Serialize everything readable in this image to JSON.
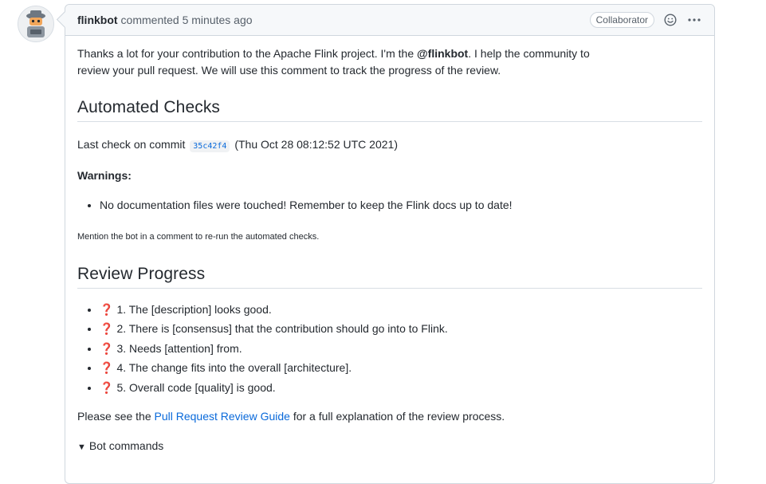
{
  "author": "flinkbot",
  "comment_action": "commented 5 minutes ago",
  "badge": "Collaborator",
  "intro": {
    "part1": "Thanks a lot for your contribution to the Apache Flink project. I'm the ",
    "mention": "@flinkbot",
    "part2": ". I help the community to review your pull request. We will use this comment to track the progress of the review."
  },
  "automated_checks": {
    "heading": "Automated Checks",
    "last_check_prefix": "Last check on commit",
    "commit_sha": "35c42f4",
    "last_check_date": "(Thu Oct 28 08:12:52 UTC 2021)",
    "warnings_label": "Warnings:",
    "warnings": [
      "No documentation files were touched! Remember to keep the Flink docs up to date!"
    ],
    "rerun_note": "Mention the bot in a comment to re-run the automated checks."
  },
  "review_progress": {
    "heading": "Review Progress",
    "items": [
      "1. The [description] looks good.",
      "2. There is [consensus] that the contribution should go into to Flink.",
      "3. Needs [attention] from.",
      "4. The change fits into the overall [architecture].",
      "5. Overall code [quality] is good."
    ],
    "status_glyph": "❓"
  },
  "guide": {
    "prefix": "Please see the ",
    "link": "Pull Request Review Guide",
    "suffix": " for a full explanation of the review process."
  },
  "bot_commands": {
    "triangle": "▼",
    "label": "Bot commands"
  }
}
